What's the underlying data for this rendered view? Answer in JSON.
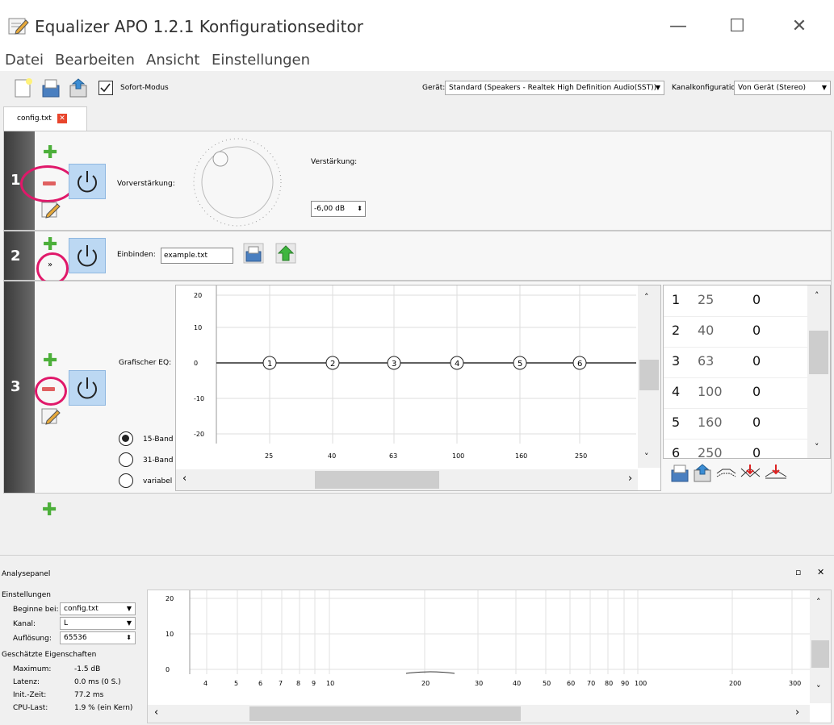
{
  "window": {
    "title": "Equalizer APO 1.2.1 Konfigurationseditor",
    "minimize": "—",
    "maximize": "☐",
    "close": "✕"
  },
  "menu": [
    "Datei",
    "Bearbeiten",
    "Ansicht",
    "Einstellungen"
  ],
  "toolbar": {
    "sofort_label": "Sofort-Modus",
    "geraet_label": "Gerät:",
    "geraet_value": "Standard (Speakers - Realtek High Definition Audio(SST))",
    "kanal_label": "Kanalkonfiguration:",
    "kanal_value": "Von Gerät (Stereo)"
  },
  "tab": {
    "label": "config.txt"
  },
  "rows": {
    "r1": {
      "num": "1",
      "label": "Vorverstärkung:",
      "gain_label": "Verstärkung:",
      "gain_value": "-6,00 dB"
    },
    "r2": {
      "num": "2",
      "label": "Einbinden:",
      "file": "example.txt",
      "expand": "»"
    },
    "r3": {
      "num": "3",
      "label": "Grafischer EQ:",
      "radio": [
        "15-Band",
        "31-Band",
        "variabel"
      ],
      "yticks": [
        "20",
        "10",
        "0",
        "-10",
        "-20"
      ],
      "xticks": [
        "25",
        "40",
        "63",
        "100",
        "160",
        "250"
      ],
      "bands": [
        "1",
        "2",
        "3",
        "4",
        "5",
        "6"
      ],
      "table": [
        {
          "idx": "1",
          "freq": "25",
          "gain": "0"
        },
        {
          "idx": "2",
          "freq": "40",
          "gain": "0"
        },
        {
          "idx": "3",
          "freq": "63",
          "gain": "0"
        },
        {
          "idx": "4",
          "freq": "100",
          "gain": "0"
        },
        {
          "idx": "5",
          "freq": "160",
          "gain": "0"
        },
        {
          "idx": "6",
          "freq": "250",
          "gain": "0"
        }
      ]
    }
  },
  "analysis": {
    "title": "Analysepanel",
    "settings_title": "Einstellungen",
    "beginne_label": "Beginne bei:",
    "beginne_value": "config.txt",
    "kanal_label": "Kanal:",
    "kanal_value": "L",
    "aufl_label": "Auflösung:",
    "aufl_value": "65536",
    "props_title": "Geschätzte Eigenschaften",
    "max_label": "Maximum:",
    "max_value": "-1.5 dB",
    "lat_label": "Latenz:",
    "lat_value": "0.0 ms (0 S.)",
    "init_label": "Init.-Zeit:",
    "init_value": "77.2 ms",
    "cpu_label": "CPU-Last:",
    "cpu_value": "1.9 % (ein Kern)",
    "yticks": [
      "20",
      "10",
      "0"
    ],
    "xticks": [
      "4",
      "5",
      "6",
      "7",
      "8",
      "9",
      "10",
      "20",
      "30",
      "40",
      "50",
      "60",
      "70",
      "80",
      "90",
      "100",
      "200",
      "300"
    ]
  },
  "colors": {
    "accent": "#bcd8f3",
    "annotation": "#e0186a",
    "plus": "#4caf3a",
    "minus": "#e06060"
  }
}
